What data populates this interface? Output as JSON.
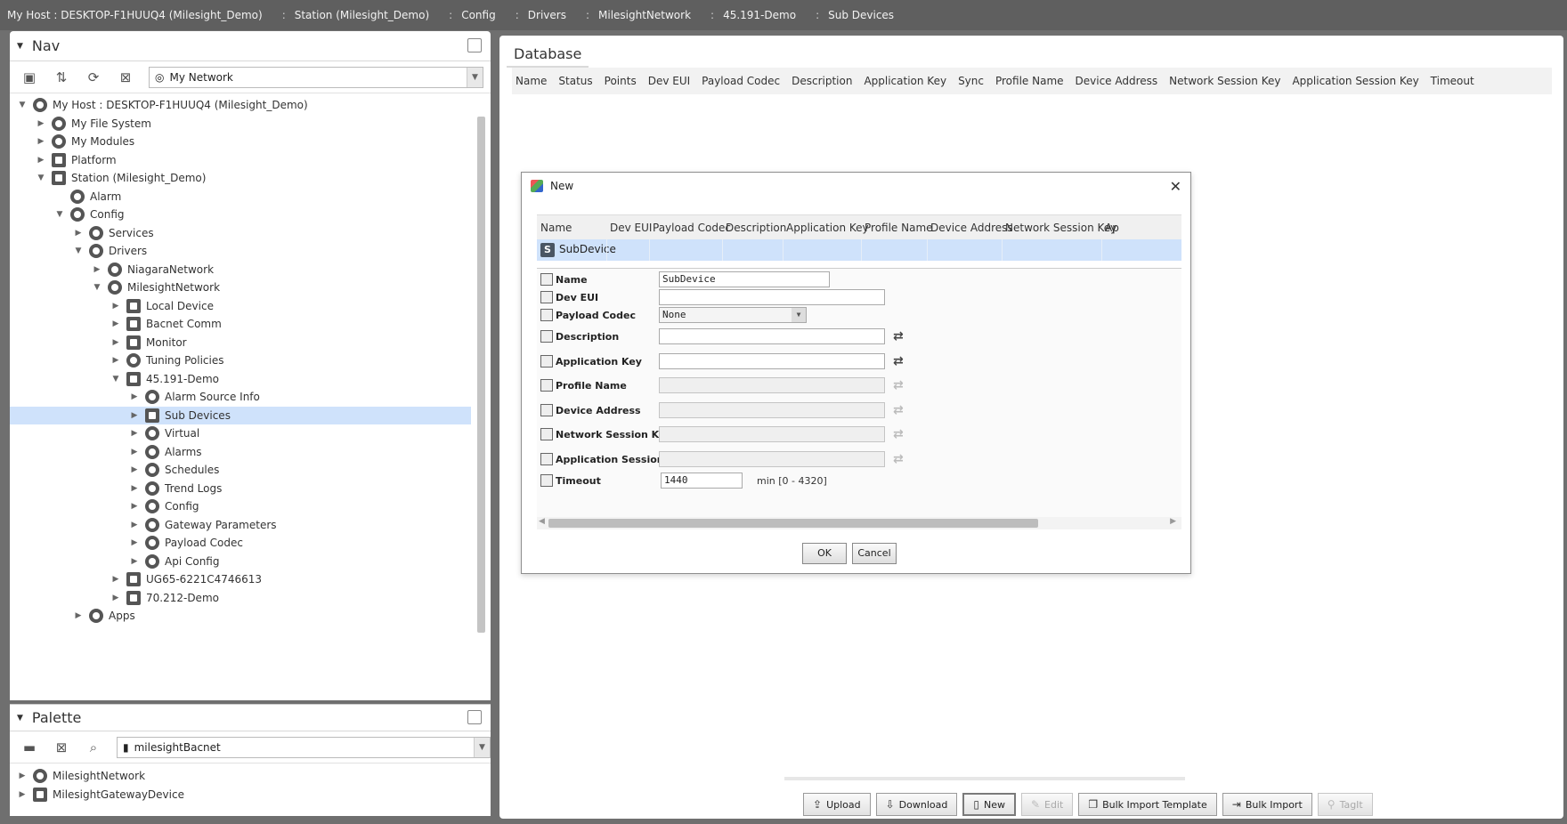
{
  "breadcrumb": [
    "My Host : DESKTOP-F1HUUQ4 (Milesight_Demo)",
    "Station (Milesight_Demo)",
    "Config",
    "Drivers",
    "MilesightNetwork",
    "45.191-Demo",
    "Sub Devices"
  ],
  "nav": {
    "title": "Nav",
    "combo_value": "My Network",
    "tree": [
      {
        "label": "My Host : DESKTOP-F1HUUQ4 (Milesight_Demo)",
        "depth": 0,
        "state": "expanded",
        "icon": "host-icon"
      },
      {
        "label": "My File System",
        "depth": 1,
        "state": "collapsed",
        "icon": "drive-icon"
      },
      {
        "label": "My Modules",
        "depth": 1,
        "state": "collapsed",
        "icon": "modules-icon"
      },
      {
        "label": "Platform",
        "depth": 1,
        "state": "collapsed",
        "icon": "platform-icon"
      },
      {
        "label": "Station (Milesight_Demo)",
        "depth": 1,
        "state": "expanded",
        "icon": "station-icon"
      },
      {
        "label": "Alarm",
        "depth": 2,
        "state": "none",
        "icon": "bell-icon"
      },
      {
        "label": "Config",
        "depth": 2,
        "state": "expanded",
        "icon": "config-icon"
      },
      {
        "label": "Services",
        "depth": 3,
        "state": "collapsed",
        "icon": "services-icon"
      },
      {
        "label": "Drivers",
        "depth": 3,
        "state": "expanded",
        "icon": "drivers-icon"
      },
      {
        "label": "NiagaraNetwork",
        "depth": 4,
        "state": "collapsed",
        "icon": "network-icon"
      },
      {
        "label": "MilesightNetwork",
        "depth": 4,
        "state": "expanded",
        "icon": "network-icon"
      },
      {
        "label": "Local Device",
        "depth": 5,
        "state": "collapsed",
        "icon": "device-icon"
      },
      {
        "label": "Bacnet Comm",
        "depth": 5,
        "state": "collapsed",
        "icon": "comm-icon"
      },
      {
        "label": "Monitor",
        "depth": 5,
        "state": "collapsed",
        "icon": "monitor-icon"
      },
      {
        "label": "Tuning Policies",
        "depth": 5,
        "state": "collapsed",
        "icon": "tuning-icon"
      },
      {
        "label": "45.191-Demo",
        "depth": 5,
        "state": "expanded",
        "icon": "gateway-icon"
      },
      {
        "label": "Alarm Source Info",
        "depth": 6,
        "state": "collapsed",
        "icon": "alarm-source-icon"
      },
      {
        "label": "Sub Devices",
        "depth": 6,
        "state": "collapsed",
        "icon": "sub-devices-icon",
        "selected": true
      },
      {
        "label": "Virtual",
        "depth": 6,
        "state": "collapsed",
        "icon": "virtual-icon"
      },
      {
        "label": "Alarms",
        "depth": 6,
        "state": "collapsed",
        "icon": "alarms-icon"
      },
      {
        "label": "Schedules",
        "depth": 6,
        "state": "collapsed",
        "icon": "schedules-icon"
      },
      {
        "label": "Trend Logs",
        "depth": 6,
        "state": "collapsed",
        "icon": "trend-icon"
      },
      {
        "label": "Config",
        "depth": 6,
        "state": "collapsed",
        "icon": "config-icon"
      },
      {
        "label": "Gateway Parameters",
        "depth": 6,
        "state": "collapsed",
        "icon": "gear-icon"
      },
      {
        "label": "Payload Codec",
        "depth": 6,
        "state": "collapsed",
        "icon": "puzzle-icon"
      },
      {
        "label": "Api Config",
        "depth": 6,
        "state": "collapsed",
        "icon": "puzzle-icon"
      },
      {
        "label": "UG65-6221C4746613",
        "depth": 5,
        "state": "collapsed",
        "icon": "gateway-icon"
      },
      {
        "label": "70.212-Demo",
        "depth": 5,
        "state": "collapsed",
        "icon": "gateway-icon"
      },
      {
        "label": "Apps",
        "depth": 3,
        "state": "collapsed",
        "icon": "apps-icon"
      }
    ]
  },
  "palette": {
    "title": "Palette",
    "combo_value": "milesightBacnet",
    "items": [
      "MilesightNetwork",
      "MilesightGatewayDevice"
    ]
  },
  "main": {
    "tab": "Database",
    "columns": [
      "Name",
      "Status",
      "Points",
      "Dev EUI",
      "Payload Codec",
      "Description",
      "Application Key",
      "Sync",
      "Profile Name",
      "Device Address",
      "Network Session Key",
      "Application Session Key",
      "Timeout"
    ],
    "buttons": [
      {
        "label": "Upload",
        "icon": "upload-icon",
        "enabled": true
      },
      {
        "label": "Download",
        "icon": "download-icon",
        "enabled": true
      },
      {
        "label": "New",
        "icon": "new-icon",
        "enabled": true
      },
      {
        "label": "Edit",
        "icon": "edit-icon",
        "enabled": false
      },
      {
        "label": "Bulk Import Template",
        "icon": "template-icon",
        "enabled": true
      },
      {
        "label": "Bulk Import",
        "icon": "import-icon",
        "enabled": true
      },
      {
        "label": "TagIt",
        "icon": "tag-icon",
        "enabled": false
      }
    ]
  },
  "dialog": {
    "title": "New",
    "columns": [
      "Name",
      "Dev EUI",
      "Payload Codec",
      "Description",
      "Application Key",
      "Profile Name",
      "Device Address",
      "Network Session Key",
      "Ap"
    ],
    "row_name": "SubDevice",
    "fields": [
      {
        "label": "Name",
        "value": "SubDevice",
        "type": "text"
      },
      {
        "label": "Dev EUI",
        "value": "",
        "type": "text"
      },
      {
        "label": "Payload Codec",
        "value": "None",
        "type": "select"
      },
      {
        "label": "Description",
        "value": "",
        "type": "text",
        "trailing": "enabled"
      },
      {
        "label": "Application Key",
        "value": "",
        "type": "text",
        "trailing": "enabled"
      },
      {
        "label": "Profile Name",
        "value": "",
        "type": "disabled",
        "trailing": "disabled"
      },
      {
        "label": "Device Address",
        "value": "",
        "type": "disabled",
        "trailing": "disabled"
      },
      {
        "label": "Network Session Key",
        "value": "",
        "type": "disabled",
        "trailing": "disabled"
      },
      {
        "label": "Application Session Key",
        "value": "",
        "type": "disabled",
        "trailing": "disabled"
      },
      {
        "label": "Timeout",
        "value": "1440",
        "type": "number",
        "unit": "min [0 - 4320]"
      }
    ],
    "ok_label": "OK",
    "cancel_label": "Cancel"
  },
  "colors": {
    "selection": "#cfe2fb",
    "chrome": "#6f6f6f"
  }
}
